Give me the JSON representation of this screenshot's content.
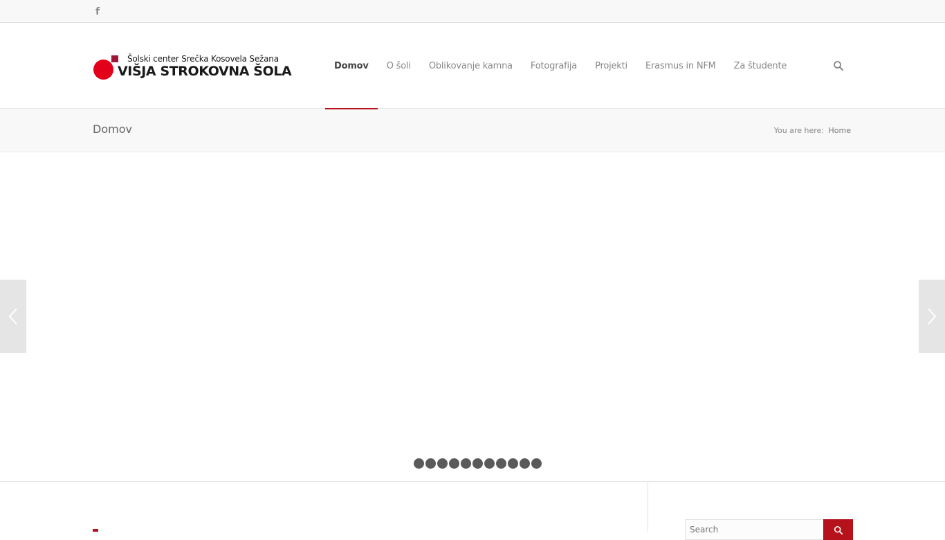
{
  "topbar": {
    "social_icon": "facebook-icon"
  },
  "logo": {
    "line1": "Šolski center Srečka Kosovela Sežana",
    "line2": "VIŠJA STROKOVNA ŠOLA",
    "colors": {
      "dot": "#e2001a",
      "square": "#a0163a"
    }
  },
  "nav": {
    "items": [
      {
        "label": "Domov",
        "active": true
      },
      {
        "label": "O šoli"
      },
      {
        "label": "Oblikovanje kamna"
      },
      {
        "label": "Fotografija"
      },
      {
        "label": "Projekti"
      },
      {
        "label": "Erasmus in NFM"
      },
      {
        "label": "Za študente"
      }
    ],
    "search_icon": "search-icon",
    "accent_color": "#b5121b"
  },
  "title_bar": {
    "title": "Domov",
    "breadcrumb_prefix": "You are here:",
    "breadcrumb_link": "Home"
  },
  "slider": {
    "prev_icon": "chevron-left-icon",
    "next_icon": "chevron-right-icon",
    "slide_count": 11,
    "active_slide": 1
  },
  "sidebar": {
    "search_placeholder": "Search",
    "search_button_icon": "search-icon"
  }
}
